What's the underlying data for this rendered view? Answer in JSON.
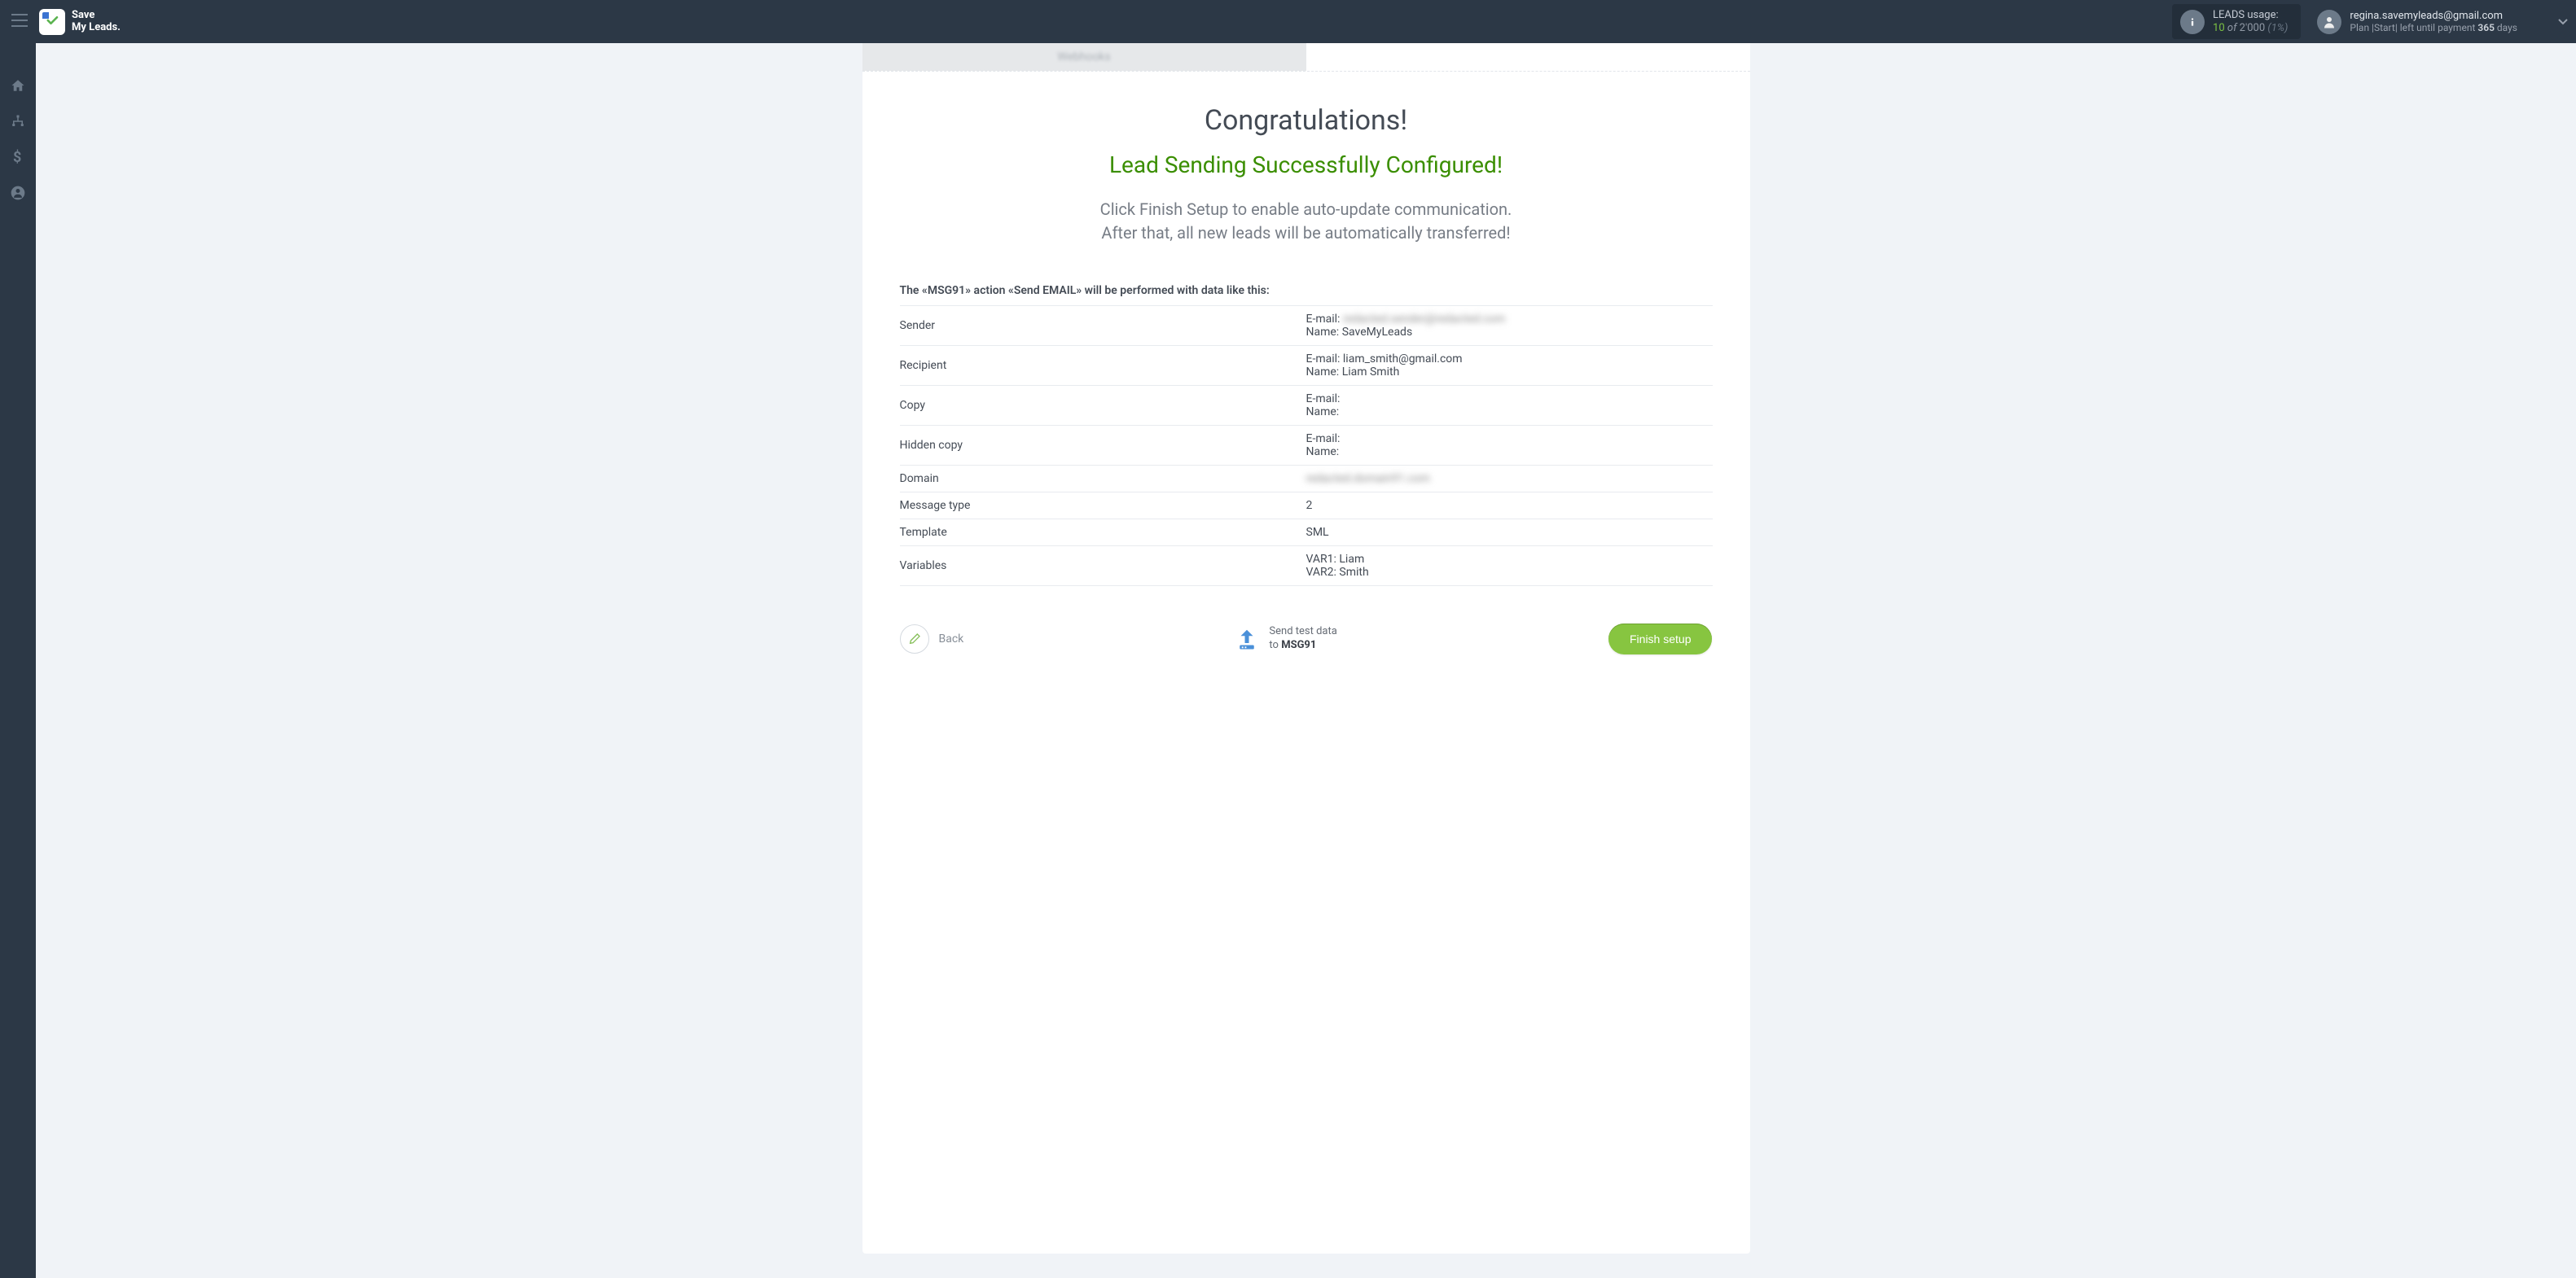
{
  "logo": {
    "line1": "Save",
    "line2": "My Leads."
  },
  "usage": {
    "label": "LEADS usage:",
    "used": "10",
    "of_word": "of",
    "total": "2'000",
    "pct": "(1%)"
  },
  "account": {
    "email": "regina.savemyleads@gmail.com",
    "plan_prefix": "Plan |Start| left until payment ",
    "days": "365",
    "days_suffix": " days"
  },
  "tabs": [
    "Webhooks",
    ""
  ],
  "headline": "Congratulations!",
  "subhead": "Lead Sending Successfully Configured!",
  "desc_line1": "Click Finish Setup to enable auto-update communication.",
  "desc_line2": "After that, all new leads will be automatically transferred!",
  "review_label": "The «MSG91» action «Send EMAIL» will be performed with data like this:",
  "rows": {
    "sender": {
      "k": "Sender",
      "email_blur": "redacted.sender@redacted.com",
      "name": "SaveMyLeads"
    },
    "recipient": {
      "k": "Recipient",
      "email": "liam_smith@gmail.com",
      "name": "Liam Smith"
    },
    "copy": {
      "k": "Copy"
    },
    "hidden_copy": {
      "k": "Hidden copy"
    },
    "domain": {
      "k": "Domain",
      "val_blur": "redacted.domain91.com"
    },
    "msgtype": {
      "k": "Message type",
      "val": "2"
    },
    "template": {
      "k": "Template",
      "val": "SML"
    },
    "variables": {
      "k": "Variables",
      "v1": "VAR1: Liam",
      "v2": "VAR2: Smith"
    }
  },
  "footer": {
    "back": "Back",
    "send_line1": "Send test data",
    "send_to": "to ",
    "send_dest": "MSG91",
    "finish": "Finish setup"
  },
  "labels": {
    "email": "E-mail:",
    "name": "Name:"
  }
}
